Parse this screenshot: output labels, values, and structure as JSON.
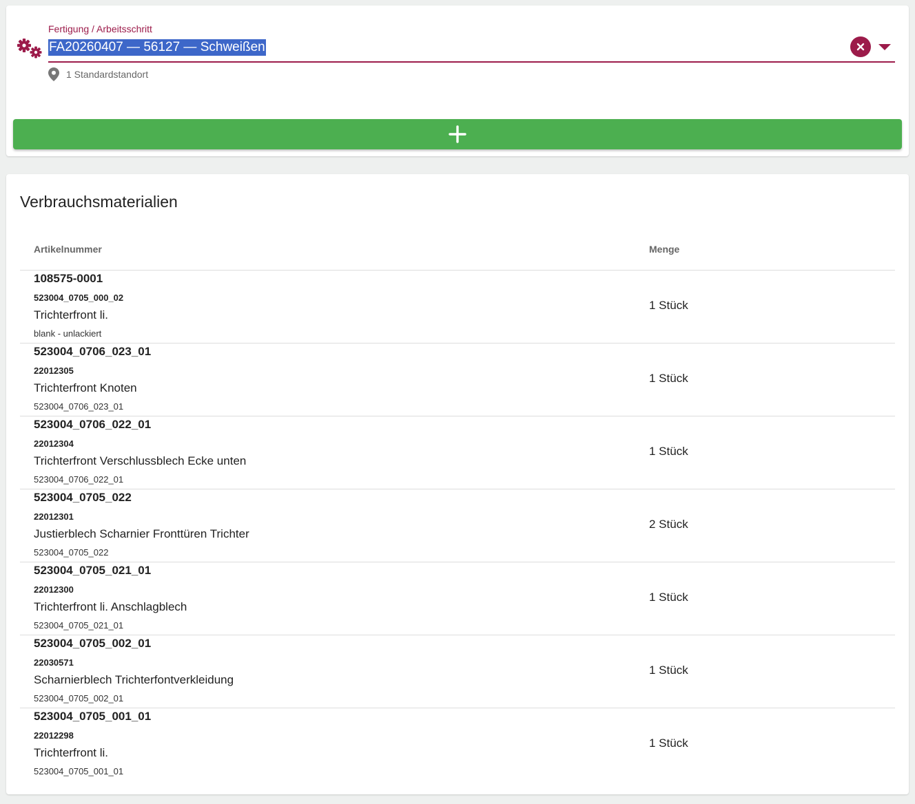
{
  "colors": {
    "accent": "#9c1b4a",
    "selection": "#3d67c9",
    "add_button": "#4caf50"
  },
  "selector": {
    "icon": "gears-icon",
    "label": "Fertigung / Arbeitsschritt",
    "value": "FA20260407 — 56127 — Schweißen",
    "location": "1 Standardstandort",
    "location_icon": "map-pin-icon",
    "clear_icon": "close-icon",
    "dropdown_icon": "caret-down-icon"
  },
  "add_button": {
    "icon": "plus-icon"
  },
  "materials": {
    "title": "Verbrauchsmaterialien",
    "columns": {
      "article": "Artikelnummer",
      "quantity": "Menge"
    },
    "rows": [
      {
        "article": "108575-0001",
        "code": "523004_0705_000_02",
        "name": "Trichterfront li.",
        "sub": "blank - unlackiert",
        "qty": "1 Stück"
      },
      {
        "article": "523004_0706_023_01",
        "code": "22012305",
        "name": "Trichterfront Knoten",
        "sub": "523004_0706_023_01",
        "qty": "1 Stück"
      },
      {
        "article": "523004_0706_022_01",
        "code": "22012304",
        "name": "Trichterfront Verschlussblech Ecke unten",
        "sub": "523004_0706_022_01",
        "qty": "1 Stück"
      },
      {
        "article": "523004_0705_022",
        "code": "22012301",
        "name": "Justierblech Scharnier Fronttüren Trichter",
        "sub": "523004_0705_022",
        "qty": "2 Stück"
      },
      {
        "article": "523004_0705_021_01",
        "code": "22012300",
        "name": "Trichterfront li. Anschlagblech",
        "sub": "523004_0705_021_01",
        "qty": "1 Stück"
      },
      {
        "article": "523004_0705_002_01",
        "code": "22030571",
        "name": "Scharnierblech Trichterfontverkleidung",
        "sub": "523004_0705_002_01",
        "qty": "1 Stück"
      },
      {
        "article": "523004_0705_001_01",
        "code": "22012298",
        "name": "Trichterfront li.",
        "sub": "523004_0705_001_01",
        "qty": "1 Stück"
      }
    ]
  }
}
